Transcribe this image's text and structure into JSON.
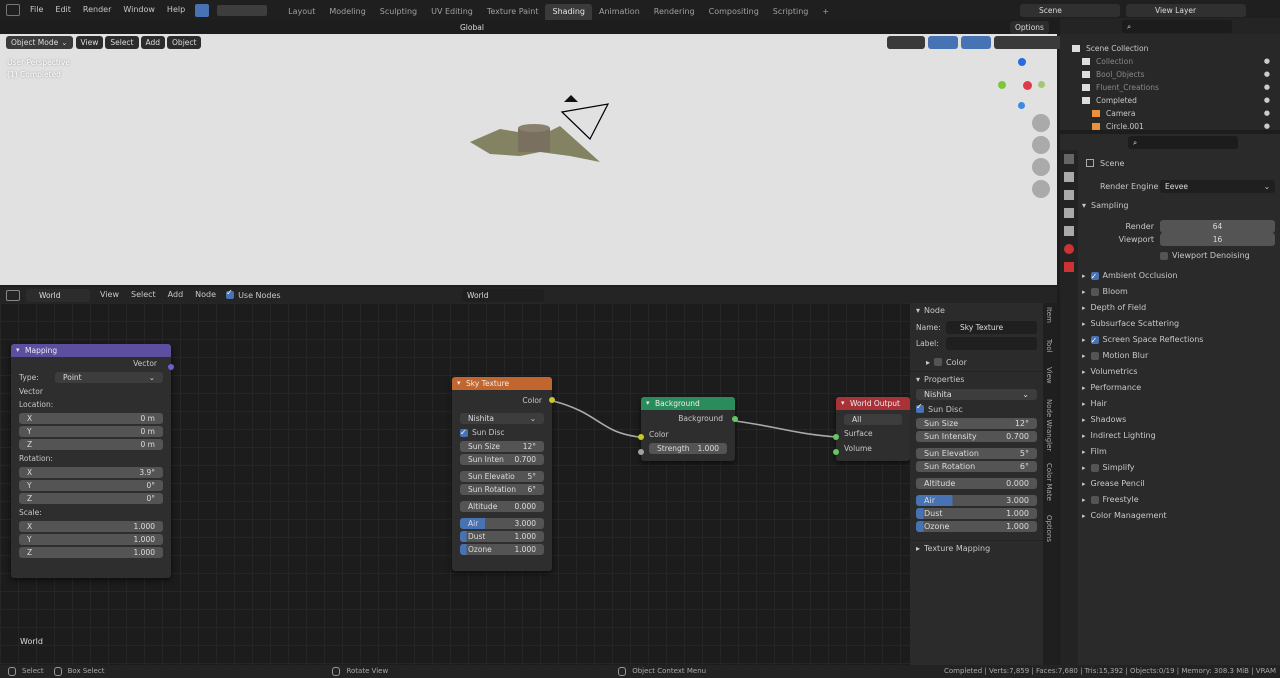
{
  "topbar": {
    "menus": [
      "File",
      "Edit",
      "Render",
      "Window",
      "Help"
    ],
    "workspaces": [
      "Layout",
      "Modeling",
      "Sculpting",
      "UV Editing",
      "Texture Paint",
      "Shading",
      "Animation",
      "Rendering",
      "Compositing",
      "Scripting"
    ],
    "active_workspace": "Shading",
    "add_tab": "+",
    "scene": "Scene",
    "view_layer": "View Layer"
  },
  "viewport": {
    "mode": "Object Mode",
    "menus": [
      "View",
      "Select",
      "Add",
      "Object"
    ],
    "orientation": "Global",
    "options": "Options",
    "overlay_title": "User Perspective",
    "overlay_sub": "(1) Completed"
  },
  "node_editor": {
    "type": "World",
    "menus": [
      "View",
      "Select",
      "Add",
      "Node"
    ],
    "use_nodes": "Use Nodes",
    "world_name": "World",
    "footer_label": "World",
    "mapping": {
      "title": "Mapping",
      "out": "Vector",
      "type_label": "Type:",
      "type_value": "Point",
      "vector_label": "Vector",
      "location_label": "Location:",
      "location": [
        [
          "X",
          "0 m"
        ],
        [
          "Y",
          "0 m"
        ],
        [
          "Z",
          "0 m"
        ]
      ],
      "rotation_label": "Rotation:",
      "rotation": [
        [
          "X",
          "3.9°"
        ],
        [
          "Y",
          "0°"
        ],
        [
          "Z",
          "0°"
        ]
      ],
      "scale_label": "Scale:",
      "scale": [
        [
          "X",
          "1.000"
        ],
        [
          "Y",
          "1.000"
        ],
        [
          "Z",
          "1.000"
        ]
      ]
    },
    "sky": {
      "title": "Sky Texture",
      "out": "Color",
      "model": "Nishita",
      "sun_disc": "Sun Disc",
      "sun_size": [
        "Sun Size",
        "12°"
      ],
      "sun_intensity": [
        "Sun Inten",
        "0.700"
      ],
      "sun_elevation": [
        "Sun Elevatio",
        "5°"
      ],
      "sun_rotation": [
        "Sun Rotation",
        "6°"
      ],
      "altitude": [
        "Altitude",
        "0.000"
      ],
      "air": [
        "Air",
        "3.000"
      ],
      "dust": [
        "Dust",
        "1.000"
      ],
      "ozone": [
        "Ozone",
        "1.000"
      ]
    },
    "background": {
      "title": "Background",
      "out": "Background",
      "in_color": "Color",
      "strength": [
        "Strength",
        "1.000"
      ]
    },
    "output": {
      "title": "World Output",
      "target": "All",
      "surface": "Surface",
      "volume": "Volume"
    }
  },
  "n_panel": {
    "section": "Node",
    "name_label": "Name:",
    "name_value": "Sky Texture",
    "label_label": "Label:",
    "color": "Color",
    "properties": "Properties",
    "model": "Nishita",
    "sun_disc": "Sun Disc",
    "fields": [
      [
        "Sun Size",
        "12°"
      ],
      [
        "Sun Intensity",
        "0.700"
      ],
      [
        "Sun Elevation",
        "5°"
      ],
      [
        "Sun Rotation",
        "6°"
      ],
      [
        "Altitude",
        "0.000"
      ],
      [
        "Air",
        "3.000"
      ],
      [
        "Dust",
        "1.000"
      ],
      [
        "Ozone",
        "1.000"
      ]
    ],
    "texture_mapping": "Texture Mapping",
    "tabs": [
      "Item",
      "Tool",
      "View",
      "Node Wrangler",
      "Color Mate",
      "Options"
    ]
  },
  "outliner": {
    "root": "Scene Collection",
    "items": [
      "Collection",
      "Bool_Objects",
      "Fluent_Creations",
      "Completed",
      "Camera",
      "Circle.001"
    ]
  },
  "properties": {
    "scene": "Scene",
    "render_engine_label": "Render Engine",
    "render_engine": "Eevee",
    "sampling": "Sampling",
    "render_label": "Render",
    "render_value": "64",
    "viewport_label": "Viewport",
    "viewport_value": "16",
    "denoise": "Viewport Denoising",
    "panels": [
      "Ambient Occlusion",
      "Bloom",
      "Depth of Field",
      "Subsurface Scattering",
      "Screen Space Reflections",
      "Motion Blur",
      "Volumetrics",
      "Performance",
      "Hair",
      "Shadows",
      "Indirect Lighting",
      "Film",
      "Simplify",
      "Grease Pencil",
      "Freestyle",
      "Color Management"
    ]
  },
  "statusbar": {
    "select": "Select",
    "box_select": "Box Select",
    "rotate_view": "Rotate View",
    "context_menu": "Object Context Menu",
    "stats": "Completed | Verts:7,859 | Faces:7,680 | Tris:15,392 | Objects:0/19 | Memory: 308.3 MiB | VRAM"
  },
  "colors": {
    "mapping": "#5e4ea0",
    "sky": "#c0662e",
    "background": "#2a8c5a",
    "output": "#a83238",
    "accent": "#4772b3"
  }
}
